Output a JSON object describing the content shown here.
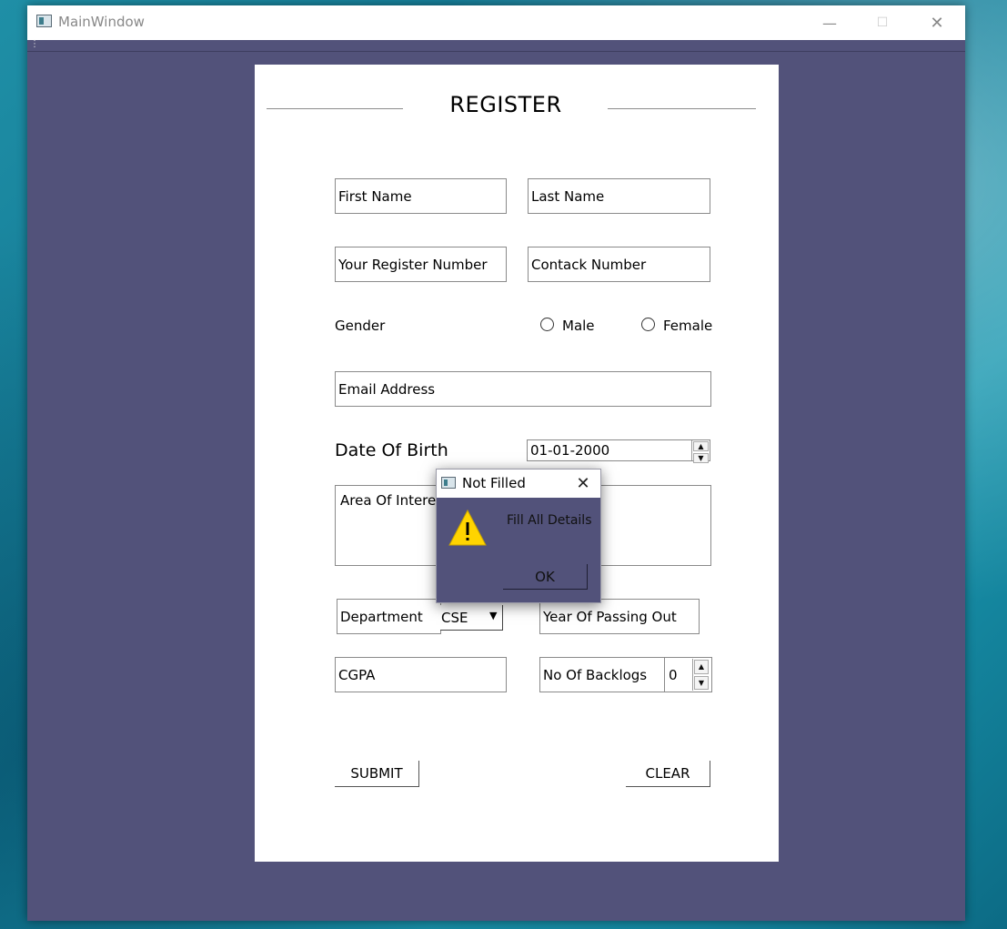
{
  "window": {
    "title": "MainWindow",
    "minimize": "—",
    "maximize": "☐",
    "close": "✕"
  },
  "form": {
    "title": "REGISTER",
    "first_name_placeholder": "First Name",
    "last_name_placeholder": "Last Name",
    "register_number_placeholder": "Your Register Number",
    "contact_number_placeholder": "Contack Number",
    "gender_label": "Gender",
    "gender_options": [
      "Male",
      "Female"
    ],
    "email_placeholder": "Email Address",
    "dob_label": "Date Of Birth",
    "dob_value": "01-01-2000",
    "area_of_interest_placeholder": "Area Of Interest",
    "department_label": "Department",
    "department_value": "CSE",
    "year_of_passing_placeholder": "Year Of Passing Out",
    "cgpa_placeholder": "CGPA",
    "backlogs_label": "No Of Backlogs",
    "backlogs_value": "0",
    "submit_label": "SUBMIT",
    "clear_label": "CLEAR"
  },
  "dialog": {
    "title": "Not Filled",
    "close": "✕",
    "message": "Fill All Details",
    "ok_label": "OK",
    "icon": "warning-icon",
    "icon_color": "#ffd400"
  },
  "colors": {
    "window_background": "#52527a",
    "panel_background": "#ffffff"
  }
}
